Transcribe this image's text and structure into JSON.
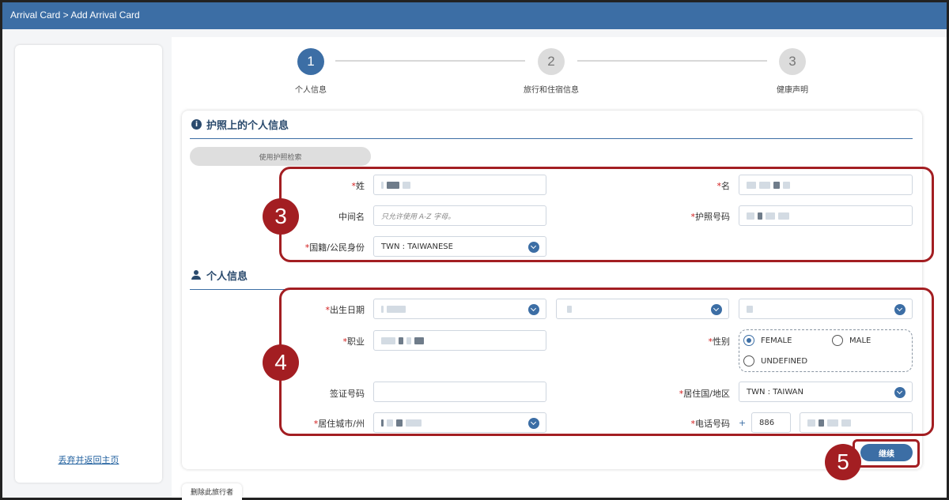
{
  "topbar": {
    "breadcrumb": "Arrival Card > Add Arrival Card"
  },
  "sidebar": {
    "discard_link": "丢弃并返回主页"
  },
  "steps": [
    {
      "number": "1",
      "label": "个人信息",
      "active": true
    },
    {
      "number": "2",
      "label": "旅行和住宿信息",
      "active": false
    },
    {
      "number": "3",
      "label": "健康声明",
      "active": false
    }
  ],
  "passport_section": {
    "title": "护照上的个人信息",
    "scan_button": "使用护照检索",
    "fields": {
      "surname_label": "姓",
      "given_name_label": "名",
      "middle_name_label": "中间名",
      "middle_name_placeholder": "只允许使用 A-Z 字母。",
      "passport_no_label": "护照号码",
      "nationality_label": "国籍/公民身份",
      "nationality_value": "TWN : TAIWANESE"
    }
  },
  "personal_section": {
    "title": "个人信息",
    "fields": {
      "dob_label": "出生日期",
      "occupation_label": "职业",
      "gender_label": "性别",
      "gender_options": [
        "FEMALE",
        "MALE",
        "UNDEFINED"
      ],
      "gender_selected": "FEMALE",
      "visa_label": "签证号码",
      "residence_country_label": "居住国/地区",
      "residence_country_value": "TWN : TAIWAN",
      "residence_city_label": "居住城市/州",
      "phone_label": "电话号码",
      "phone_plus": "+",
      "phone_code": "886"
    }
  },
  "buttons": {
    "continue": "继续",
    "delete_traveler": "删除此旅行者"
  },
  "annotations": [
    "3",
    "4",
    "5"
  ],
  "colors": {
    "primary": "#3c6ea5",
    "highlight": "#a31e22",
    "required": "#d21a1a"
  }
}
